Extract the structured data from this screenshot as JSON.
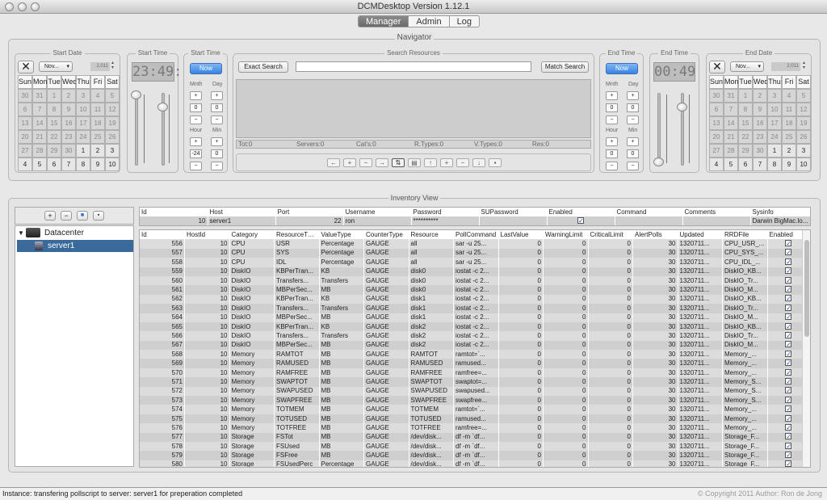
{
  "window": {
    "title": "DCMDesktop Version 1.12.1"
  },
  "tabs": [
    {
      "label": "Manager",
      "active": true
    },
    {
      "label": "Admin"
    },
    {
      "label": "Log"
    }
  ],
  "navigator": {
    "title": "Navigator",
    "start_date": {
      "title": "Start Date",
      "month": "Nov...",
      "year": "2,011",
      "weekdays": [
        "Sun",
        "Mon",
        "Tue",
        "Wed",
        "Thu",
        "Fri",
        "Sat"
      ],
      "weeks": [
        [
          "30",
          "31",
          "1",
          "2",
          "3",
          "4",
          "5"
        ],
        [
          "6",
          "7",
          "8",
          "9",
          "10",
          "11",
          "12"
        ],
        [
          "13",
          "14",
          "15",
          "16",
          "17",
          "18",
          "19"
        ],
        [
          "20",
          "21",
          "22",
          "23",
          "24",
          "25",
          "26"
        ],
        [
          "27",
          "28",
          "29",
          "30",
          "1",
          "2",
          "3"
        ],
        [
          "4",
          "5",
          "6",
          "7",
          "8",
          "9",
          "10"
        ]
      ]
    },
    "start_time": {
      "title": "Start Time",
      "clock": "23:49:",
      "slider_title": "Start Time",
      "now": "Now",
      "mnth_label": "Mnth",
      "day_label": "Day",
      "hour_label": "Hour",
      "min_label": "Min",
      "mnth": "0",
      "day": "0",
      "hour": "-24",
      "min": "0"
    },
    "search": {
      "title": "Search Resources",
      "exact_label": "Exact Search",
      "match_label": "Match Search",
      "query": "",
      "counts": [
        {
          "label": "Tot:",
          "value": "0"
        },
        {
          "label": "Servers:",
          "value": "0"
        },
        {
          "label": "Cat's:",
          "value": "0"
        },
        {
          "label": "R.Types:",
          "value": "0"
        },
        {
          "label": "V.Types:",
          "value": "0"
        },
        {
          "label": "Res:",
          "value": "0"
        }
      ]
    },
    "end_time": {
      "title": "End Time",
      "clock": "00:49",
      "slider_title": "End Time",
      "now": "Now",
      "mnth_label": "Mnth",
      "day_label": "Day",
      "hour_label": "Hour",
      "min_label": "Min",
      "mnth": "0",
      "day": "0",
      "hour": "0",
      "min": "0"
    },
    "end_date": {
      "title": "End Date",
      "month": "Nov...",
      "year": "2,011",
      "weekdays": [
        "Sun",
        "Mon",
        "Tue",
        "Wed",
        "Thu",
        "Fri",
        "Sat"
      ],
      "weeks": [
        [
          "30",
          "31",
          "1",
          "2",
          "3",
          "4",
          "5"
        ],
        [
          "6",
          "7",
          "8",
          "9",
          "10",
          "11",
          "12"
        ],
        [
          "13",
          "14",
          "15",
          "16",
          "17",
          "18",
          "19"
        ],
        [
          "20",
          "21",
          "22",
          "23",
          "24",
          "25",
          "26"
        ],
        [
          "27",
          "28",
          "29",
          "30",
          "1",
          "2",
          "3"
        ],
        [
          "4",
          "5",
          "6",
          "7",
          "8",
          "9",
          "10"
        ]
      ]
    }
  },
  "inventory": {
    "title": "Inventory View",
    "tree": {
      "root": "Datacenter",
      "child": "server1"
    },
    "host_table": {
      "headers": [
        "Id",
        "Host",
        "Port",
        "Username",
        "Password",
        "SUPassword",
        "Enabled",
        "Command",
        "Comments",
        "Sysinfo"
      ],
      "row": {
        "id": "10",
        "host": "server1",
        "port": "22",
        "username": "ron",
        "password": "**********",
        "supassword": "",
        "enabled": "✓",
        "command": "",
        "comments": "",
        "sysinfo": "Darwin BigMac.lo..."
      }
    },
    "resource_table": {
      "headers": [
        "Id",
        "HostId",
        "Category",
        "ResourceType",
        "ValueType",
        "CounterType",
        "Resource",
        "PollCommand",
        "LastValue",
        "WarningLimit",
        "CriticalLimit",
        "AlertPolls",
        "Updated",
        "RRDFile",
        "Enabled"
      ],
      "rows": [
        [
          "556",
          "10",
          "CPU",
          "USR",
          "Percentage",
          "GAUGE",
          "all",
          "sar -u 25...",
          "0",
          "0",
          "0",
          "30",
          "1320711...",
          "CPU_USR_...",
          "✓"
        ],
        [
          "557",
          "10",
          "CPU",
          "SYS",
          "Percentage",
          "GAUGE",
          "all",
          "sar -u 25...",
          "0",
          "0",
          "0",
          "30",
          "1320711...",
          "CPU_SYS_...",
          "✓"
        ],
        [
          "558",
          "10",
          "CPU",
          "IDL",
          "Percentage",
          "GAUGE",
          "all",
          "sar -u 25...",
          "0",
          "0",
          "0",
          "30",
          "1320711...",
          "CPU_IDL_...",
          "✓"
        ],
        [
          "559",
          "10",
          "DiskIO",
          "KBPerTran...",
          "KB",
          "GAUGE",
          "disk0",
          "iostat -c 2...",
          "0",
          "0",
          "0",
          "30",
          "1320711...",
          "DiskIO_KB...",
          "✓"
        ],
        [
          "560",
          "10",
          "DiskIO",
          "Transfers...",
          "Transfers",
          "GAUGE",
          "disk0",
          "iostat -c 2...",
          "0",
          "0",
          "0",
          "30",
          "1320711...",
          "DiskIO_Tr...",
          "✓"
        ],
        [
          "561",
          "10",
          "DiskIO",
          "MBPerSec...",
          "MB",
          "GAUGE",
          "disk0",
          "iostat -c 2...",
          "0",
          "0",
          "0",
          "30",
          "1320711...",
          "DiskIO_M...",
          "✓"
        ],
        [
          "562",
          "10",
          "DiskIO",
          "KBPerTran...",
          "KB",
          "GAUGE",
          "disk1",
          "iostat -c 2...",
          "0",
          "0",
          "0",
          "30",
          "1320711...",
          "DiskIO_KB...",
          "✓"
        ],
        [
          "563",
          "10",
          "DiskIO",
          "Transfers...",
          "Transfers",
          "GAUGE",
          "disk1",
          "iostat -c 2...",
          "0",
          "0",
          "0",
          "30",
          "1320711...",
          "DiskIO_Tr...",
          "✓"
        ],
        [
          "564",
          "10",
          "DiskIO",
          "MBPerSec...",
          "MB",
          "GAUGE",
          "disk1",
          "iostat -c 2...",
          "0",
          "0",
          "0",
          "30",
          "1320711...",
          "DiskIO_M...",
          "✓"
        ],
        [
          "565",
          "10",
          "DiskIO",
          "KBPerTran...",
          "KB",
          "GAUGE",
          "disk2",
          "iostat -c 2...",
          "0",
          "0",
          "0",
          "30",
          "1320711...",
          "DiskIO_KB...",
          "✓"
        ],
        [
          "566",
          "10",
          "DiskIO",
          "Transfers...",
          "Transfers",
          "GAUGE",
          "disk2",
          "iostat -c 2...",
          "0",
          "0",
          "0",
          "30",
          "1320711...",
          "DiskIO_Tr...",
          "✓"
        ],
        [
          "567",
          "10",
          "DiskIO",
          "MBPerSec...",
          "MB",
          "GAUGE",
          "disk2",
          "iostat -c 2...",
          "0",
          "0",
          "0",
          "30",
          "1320711...",
          "DiskIO_M...",
          "✓"
        ],
        [
          "568",
          "10",
          "Memory",
          "RAMTOT",
          "MB",
          "GAUGE",
          "RAMTOT",
          "ramtot=`...",
          "0",
          "0",
          "0",
          "30",
          "1320711...",
          "Memory_...",
          "✓"
        ],
        [
          "569",
          "10",
          "Memory",
          "RAMUSED",
          "MB",
          "GAUGE",
          "RAMUSED",
          "ramused...",
          "0",
          "0",
          "0",
          "30",
          "1320711...",
          "Memory_...",
          "✓"
        ],
        [
          "570",
          "10",
          "Memory",
          "RAMFREE",
          "MB",
          "GAUGE",
          "RAMFREE",
          "ramfree=...",
          "0",
          "0",
          "0",
          "30",
          "1320711...",
          "Memory_...",
          "✓"
        ],
        [
          "571",
          "10",
          "Memory",
          "SWAPTOT",
          "MB",
          "GAUGE",
          "SWAPTOT",
          "swaptot=...",
          "0",
          "0",
          "0",
          "30",
          "1320711...",
          "Memory_S...",
          "✓"
        ],
        [
          "572",
          "10",
          "Memory",
          "SWAPUSED",
          "MB",
          "GAUGE",
          "SWAPUSED",
          "swapused...",
          "0",
          "0",
          "0",
          "30",
          "1320711...",
          "Memory_S...",
          "✓"
        ],
        [
          "573",
          "10",
          "Memory",
          "SWAPFREE",
          "MB",
          "GAUGE",
          "SWAPFREE",
          "swapfree...",
          "0",
          "0",
          "0",
          "30",
          "1320711...",
          "Memory_S...",
          "✓"
        ],
        [
          "574",
          "10",
          "Memory",
          "TOTMEM",
          "MB",
          "GAUGE",
          "TOTMEM",
          "ramtot=`...",
          "0",
          "0",
          "0",
          "30",
          "1320711...",
          "Memory_...",
          "✓"
        ],
        [
          "575",
          "10",
          "Memory",
          "TOTUSED",
          "MB",
          "GAUGE",
          "TOTUSED",
          "ramused...",
          "0",
          "0",
          "0",
          "30",
          "1320711...",
          "Memory_...",
          "✓"
        ],
        [
          "576",
          "10",
          "Memory",
          "TOTFREE",
          "MB",
          "GAUGE",
          "TOTFREE",
          "ramfree=...",
          "0",
          "0",
          "0",
          "30",
          "1320711...",
          "Memory_...",
          "✓"
        ],
        [
          "577",
          "10",
          "Storage",
          "FSTot",
          "MB",
          "GAUGE",
          "/dev/disk...",
          "df -m `df...",
          "0",
          "0",
          "0",
          "30",
          "1320711...",
          "Storage_F...",
          "✓"
        ],
        [
          "578",
          "10",
          "Storage",
          "FSUsed",
          "MB",
          "GAUGE",
          "/dev/disk...",
          "df -m `df...",
          "0",
          "0",
          "0",
          "30",
          "1320711...",
          "Storage_F...",
          "✓"
        ],
        [
          "579",
          "10",
          "Storage",
          "FSFree",
          "MB",
          "GAUGE",
          "/dev/disk...",
          "df -m `df...",
          "0",
          "0",
          "0",
          "30",
          "1320711...",
          "Storage_F...",
          "✓"
        ],
        [
          "580",
          "10",
          "Storage",
          "FSUsedPerc",
          "Percentage",
          "GAUGE",
          "/dev/disk...",
          "df -m `df...",
          "0",
          "0",
          "0",
          "30",
          "1320711...",
          "Storage_F...",
          "✓"
        ]
      ]
    }
  },
  "status": {
    "message": "Instance: transfering pollscript to server: server1 for preperation completed",
    "copyright": "© Copyright 2011 Author: Ron de Jong"
  },
  "colors": {
    "accent": "#3a82e0",
    "selection": "#3a6a9a"
  }
}
